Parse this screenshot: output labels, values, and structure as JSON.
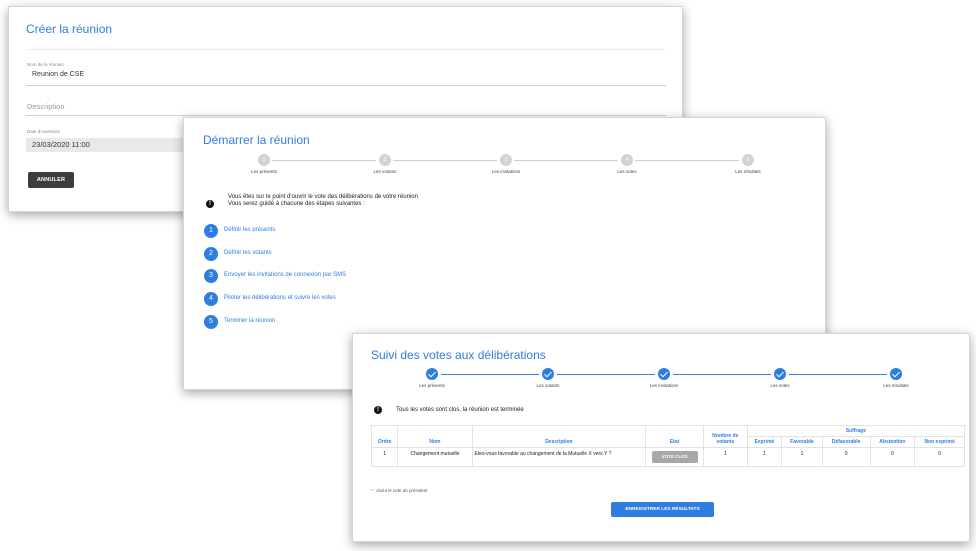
{
  "create_meeting": {
    "title": "Créer la réunion",
    "name_label": "Nom de la réunion",
    "name_value": "Reunion de CSE",
    "description_label": "Description",
    "date_label": "Date d'ouverture",
    "date_value": "23/03/2020 11:00",
    "cancel_label": "ANNULER"
  },
  "start_meeting": {
    "title": "Démarrer la réunion",
    "steps": [
      {
        "num": "1",
        "label": "Les présents"
      },
      {
        "num": "2",
        "label": "Les votants"
      },
      {
        "num": "3",
        "label": "Les invitations"
      },
      {
        "num": "4",
        "label": "Les votes"
      },
      {
        "num": "5",
        "label": "Les résultats"
      }
    ],
    "info_line1": "Vous êtes sur le point d'ouvrir le vote des délibérations de votre réunion",
    "info_line2": "Vous serez guidé à chacune des étapes suivantes :",
    "actions": [
      {
        "num": "1",
        "label": "Définir les présents"
      },
      {
        "num": "2",
        "label": "Définir les votants"
      },
      {
        "num": "3",
        "label": "Envoyer les invitations de connexion par SMS"
      },
      {
        "num": "4",
        "label": "Piloter les délibérations et suivre les votes"
      },
      {
        "num": "5",
        "label": "Terminer la réunion"
      }
    ]
  },
  "vote_tracking": {
    "title": "Suivi des votes aux délibérations",
    "steps": [
      "Les présents",
      "Les votants",
      "Les invitations",
      "Les votes",
      "Les résultats"
    ],
    "info": "Tous les votes sont clos, la réunion est terminée",
    "headers": {
      "order": "Ordre",
      "name": "Nom",
      "description": "Description",
      "state": "Etat",
      "voters": "Nombre de votants",
      "suffrage": "Suffrage",
      "expressed": "Exprimé",
      "favorable": "Favorable",
      "unfavorable": "Défavorable",
      "abstention": "Abstention",
      "not_expressed": "Non exprimé"
    },
    "rows": [
      {
        "order": "1",
        "name": "Changement mutuelle",
        "description": "Etes-vous favorable au changement de la Mutuelle X vers Y ?",
        "state_button": "VOTE CLOS",
        "voters": "1",
        "expressed": "1",
        "favorable": "1",
        "unfavorable": "0",
        "abstention": "0",
        "not_expressed": "0"
      }
    ],
    "note_star": "*",
    "note": " : inclut le vote du président",
    "save_label": "ENREGISTRER LES RÉSULTATS"
  },
  "colors": {
    "accent": "#2f7de1",
    "dark_button": "#3d3d3d",
    "inactive_step": "#d3d3d3"
  }
}
